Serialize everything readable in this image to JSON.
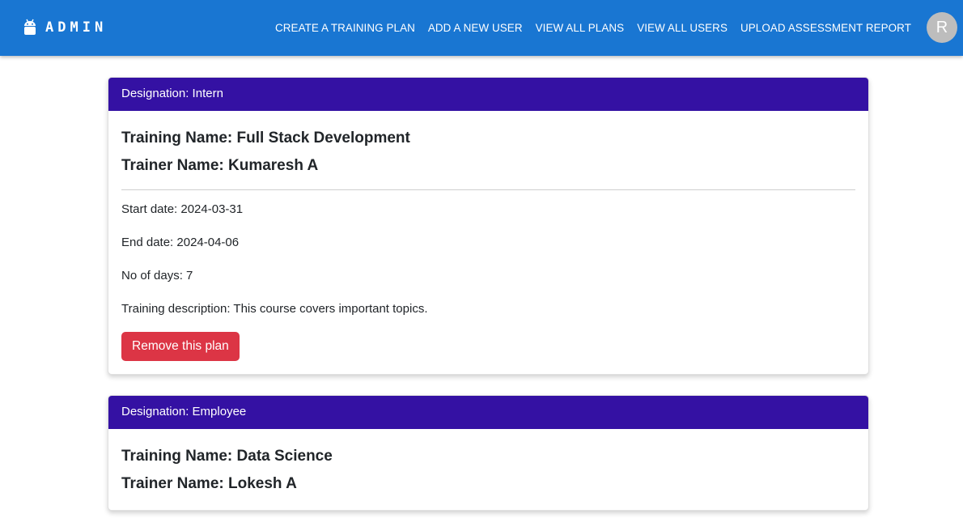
{
  "appbar": {
    "brand": "ADMIN",
    "brand_icon": "android-robot-icon",
    "nav": [
      {
        "label": "CREATE A TRAINING PLAN"
      },
      {
        "label": "ADD A NEW USER"
      },
      {
        "label": "VIEW ALL PLANS"
      },
      {
        "label": "VIEW ALL USERS"
      },
      {
        "label": "UPLOAD ASSESSMENT REPORT"
      }
    ],
    "avatar_initial": "R",
    "color": "#1976d2"
  },
  "plans": [
    {
      "designation": "Designation: Intern",
      "training_name": "Training Name: Full Stack Development",
      "trainer_name": "Trainer Name: Kumaresh A",
      "start_date": "Start date: 2024-03-31",
      "end_date": "End date: 2024-04-06",
      "days": "No of days: 7",
      "description": "Training description: This course covers important topics.",
      "remove_label": "Remove this plan"
    },
    {
      "designation": "Designation: Employee",
      "training_name": "Training Name: Data Science",
      "trainer_name": "Trainer Name: Lokesh A"
    }
  ],
  "colors": {
    "header": "#3411a3",
    "danger": "#dc3545"
  }
}
